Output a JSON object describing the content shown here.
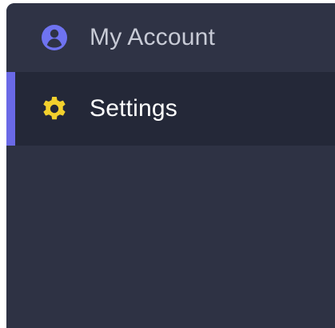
{
  "sidebar": {
    "items": [
      {
        "label": "My Account",
        "icon": "user-circle-icon",
        "icon_color": "#6f73f0",
        "active": false
      },
      {
        "label": "Settings",
        "icon": "gear-icon",
        "icon_color": "#f3d12d",
        "active": true
      }
    ],
    "colors": {
      "background": "#2e3244",
      "active_background": "#242838",
      "active_indicator": "#6a69e6",
      "inactive_text": "#c8cbd6",
      "active_text": "#ffffff"
    }
  }
}
